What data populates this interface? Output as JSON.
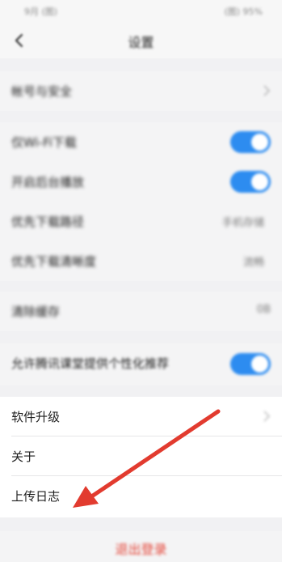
{
  "status_bar": {
    "left": "9月 (图)",
    "right": "(图) 95%"
  },
  "nav": {
    "title": "设置"
  },
  "sections": {
    "account": {
      "label": "帐号与安全"
    },
    "download": {
      "wifi_download": "仅Wi-Fi下载",
      "auto_play": "开启后台播放",
      "download_path": "优先下载路径",
      "download_path_value": "手机存储",
      "download_quality": "优先下载清晰度",
      "download_quality_value": "流畅"
    },
    "cache": {
      "label": "清除缓存",
      "value": "0B"
    },
    "recommend": {
      "label": "允许腾讯课堂提供个性化推荐"
    },
    "about": {
      "upgrade": "软件升级",
      "about": "关于",
      "upload_log": "上传日志"
    }
  },
  "logout": {
    "label": "退出登录"
  },
  "colors": {
    "accent": "#2d8cf0",
    "logout": "#e4473a",
    "arrow": "#e23b2f"
  },
  "icons": [
    "back-icon",
    "chevron-right-icon",
    "annotation-arrow"
  ]
}
